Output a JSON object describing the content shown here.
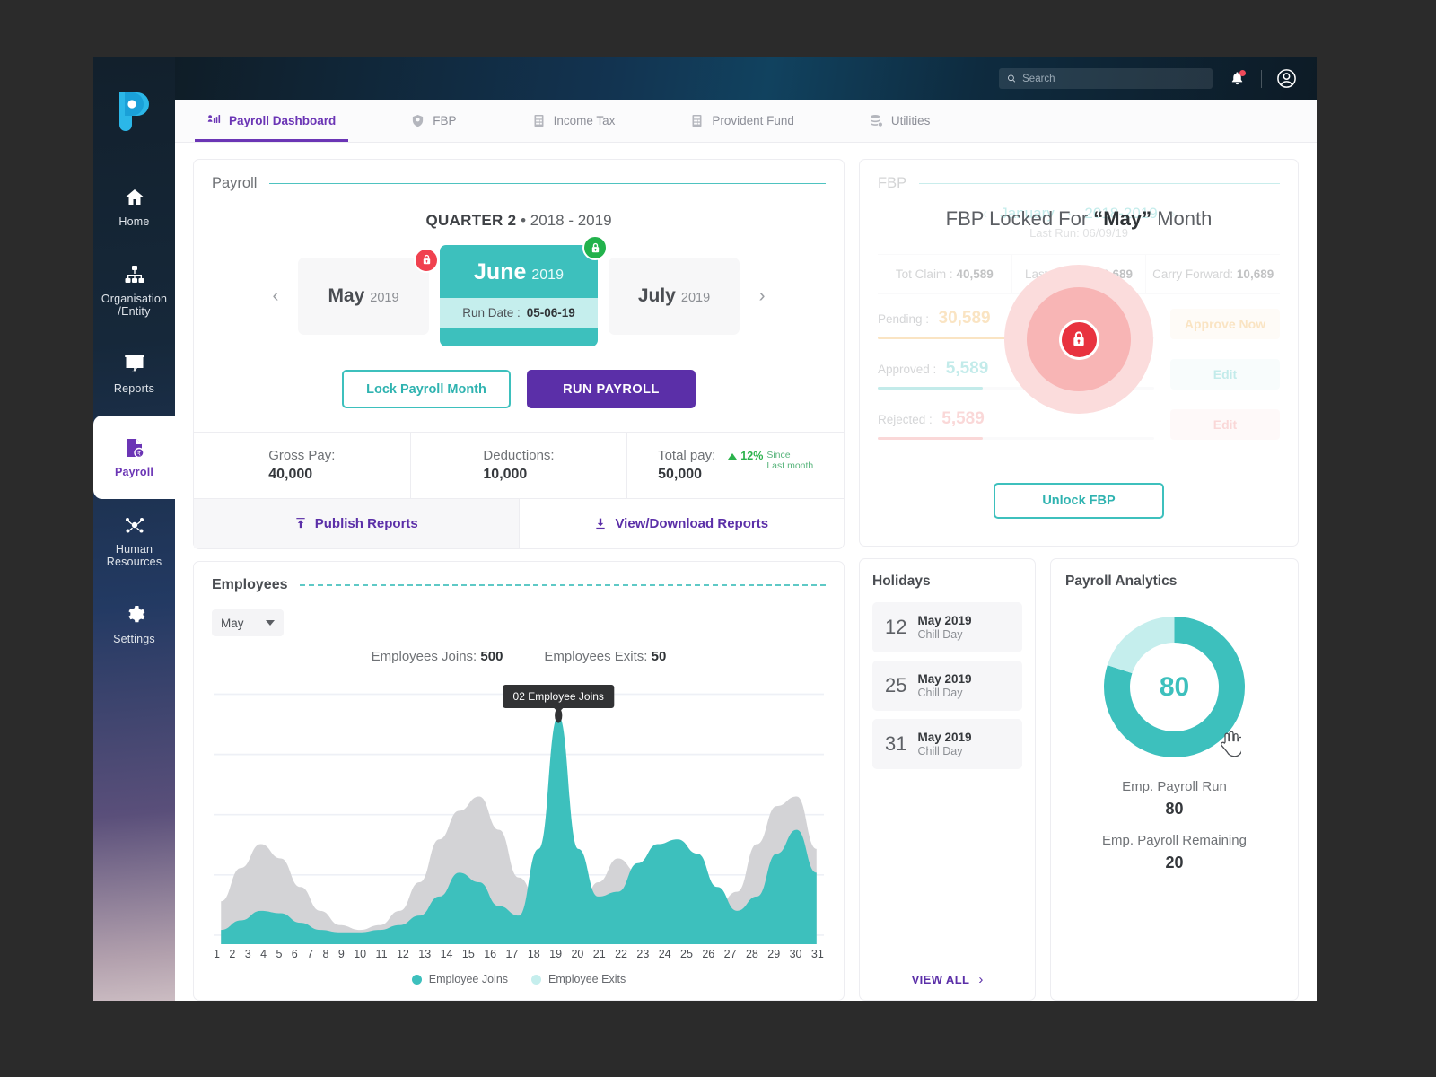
{
  "topbar": {
    "search_placeholder": "Search",
    "search_value": "",
    "bell_icon": "bell-icon",
    "avatar_icon": "user-avatar-icon"
  },
  "sidebar": {
    "logo": "pocket-hrms-logo",
    "items": [
      {
        "label": "Home",
        "icon": "home-icon",
        "active": false
      },
      {
        "label": "Organisation\n/Entity",
        "label_line1": "Organisation",
        "label_line2": "/Entity",
        "icon": "org-chart-icon",
        "active": false
      },
      {
        "label": "Reports",
        "icon": "reports-presentation-icon",
        "active": false
      },
      {
        "label": "Payroll",
        "icon": "payroll-document-icon",
        "active": true
      },
      {
        "label_line1": "Human",
        "label_line2": "Resources",
        "label": "Human Resources",
        "icon": "people-network-icon",
        "active": false
      },
      {
        "label": "Settings",
        "icon": "gear-icon",
        "active": false
      }
    ]
  },
  "tabs": [
    {
      "label": "Payroll Dashboard",
      "icon": "bar-chart-person-icon",
      "active": true
    },
    {
      "label": "FBP",
      "icon": "shield-icon",
      "active": false
    },
    {
      "label": "Income Tax",
      "icon": "calculator-icon",
      "active": false
    },
    {
      "label": "Provident Fund",
      "icon": "calculator-icon",
      "active": false
    },
    {
      "label": "Utilities",
      "icon": "stack-gear-icon",
      "active": false
    }
  ],
  "payroll": {
    "title": "Payroll",
    "quarter_label": "QUARTER 2",
    "quarter_sep": "•",
    "quarter_years": "2018 - 2019",
    "prev_arrow": "‹",
    "next_arrow": "›",
    "months": [
      {
        "name": "May",
        "year": "2019",
        "state": "locked",
        "badge_icon": "lock-closed-icon"
      },
      {
        "name": "June",
        "year": "2019",
        "state": "active",
        "badge_icon": "lock-open-icon",
        "run_date_label": "Run Date :",
        "run_date_value": "05-06-19"
      },
      {
        "name": "July",
        "year": "2019",
        "state": "default"
      }
    ],
    "lock_button": "Lock Payroll Month",
    "run_button": "RUN PAYROLL",
    "stats": [
      {
        "label": "Gross Pay:",
        "value": "40,000"
      },
      {
        "label": "Deductions:",
        "value": "10,000"
      },
      {
        "label": "Total pay:",
        "value": "50,000",
        "delta_pct": "12%",
        "delta_line1": "Since",
        "delta_line2": "Last month"
      }
    ],
    "publish_reports": "Publish Reports",
    "download_reports": "View/Download Reports"
  },
  "fbp": {
    "title": "FBP",
    "month": "January",
    "month_sep": "·",
    "years": "2018-2019",
    "last_run": "Last Run: 06/09/19",
    "stats": [
      {
        "label": "Tot Claim :",
        "value": "40,589"
      },
      {
        "label": "Last Payout:",
        "value": "50,689"
      },
      {
        "label": "Carry Forward:",
        "value": "10,689"
      }
    ],
    "rows": [
      {
        "label": "Pending :",
        "value": "30,589",
        "color": "#f0a93c",
        "fill_pct": 62,
        "action": "Approve Now",
        "action_bg": "#fdf3e5"
      },
      {
        "label": "Approved :",
        "value": "5,589",
        "color": "#3dc0bd",
        "fill_pct": 38,
        "action": "Edit",
        "action_bg": "#eaf8f7"
      },
      {
        "label": "Rejected :",
        "value": "5,589",
        "color": "#f08080",
        "fill_pct": 38,
        "action": "Edit",
        "action_bg": "#fdeeee"
      }
    ],
    "overlay_title_pre": "FBP Locked For ",
    "overlay_title_month": "“May”",
    "overlay_title_post": " Month",
    "lock_icon": "lock-closed-icon",
    "unlock_button": "Unlock FBP"
  },
  "employees": {
    "title": "Employees",
    "month_select": "May",
    "joins_label": "Employees Joins:",
    "joins_value": "500",
    "exits_label": "Employees Exits:",
    "exits_value": "50",
    "tooltip": "02 Employee Joins",
    "legend": [
      {
        "label": "Employee Joins",
        "color": "#3dc0bd"
      },
      {
        "label": "Employee Exits",
        "color": "#c5eeed"
      }
    ]
  },
  "chart_data": {
    "type": "area",
    "title": "Employees",
    "xlabel": "",
    "ylabel": "",
    "x": [
      1,
      2,
      3,
      4,
      5,
      6,
      7,
      8,
      9,
      10,
      11,
      12,
      13,
      14,
      15,
      16,
      17,
      18,
      19,
      20,
      21,
      22,
      23,
      24,
      25,
      26,
      27,
      28,
      29,
      30,
      31
    ],
    "categories": [
      "1",
      "2",
      "3",
      "4",
      "5",
      "6",
      "7",
      "8",
      "9",
      "10",
      "11",
      "12",
      "13",
      "14",
      "15",
      "16",
      "17",
      "18",
      "19",
      "20",
      "21",
      "22",
      "23",
      "24",
      "25",
      "26",
      "27",
      "28",
      "29",
      "30",
      "31"
    ],
    "series": [
      {
        "name": "Employee Joins",
        "color": "#3dc0bd",
        "values": [
          6,
          10,
          14,
          13,
          9,
          6,
          5,
          5,
          6,
          8,
          12,
          20,
          30,
          26,
          16,
          12,
          40,
          96,
          40,
          20,
          22,
          34,
          42,
          44,
          38,
          24,
          14,
          20,
          38,
          48,
          30
        ]
      },
      {
        "name": "Employee Exits",
        "color": "#d3d3d6",
        "values": [
          18,
          32,
          42,
          36,
          24,
          14,
          8,
          6,
          8,
          14,
          26,
          44,
          56,
          62,
          48,
          28,
          18,
          12,
          12,
          26,
          36,
          30,
          26,
          24,
          20,
          16,
          22,
          42,
          58,
          62,
          40
        ]
      }
    ],
    "ylim": [
      0,
      110
    ],
    "gridlines": 5,
    "grid": true,
    "legend_position": "bottom",
    "annotation": {
      "text": "02 Employee Joins",
      "x": 18,
      "series": "Employee Joins"
    }
  },
  "holidays": {
    "title": "Holidays",
    "items": [
      {
        "day": "12",
        "month": "May 2019",
        "note": "Chill Day"
      },
      {
        "day": "25",
        "month": "May 2019",
        "note": "Chill Day"
      },
      {
        "day": "31",
        "month": "May 2019",
        "note": "Chill Day"
      }
    ],
    "view_all": "VIEW ALL",
    "view_all_chevron": "›"
  },
  "analytics": {
    "title": "Payroll Analytics",
    "center_value": "80",
    "run_label": "Emp. Payroll Run",
    "run_value": "80",
    "remaining_label": "Emp. Payroll Remaining",
    "remaining_value": "20",
    "donut": {
      "type": "pie",
      "segments": [
        {
          "name": "Emp. Payroll Run",
          "value": 80,
          "color": "#3dc0bd"
        },
        {
          "name": "Emp. Payroll Remaining",
          "value": 20,
          "color": "#c5eeed"
        }
      ]
    }
  }
}
